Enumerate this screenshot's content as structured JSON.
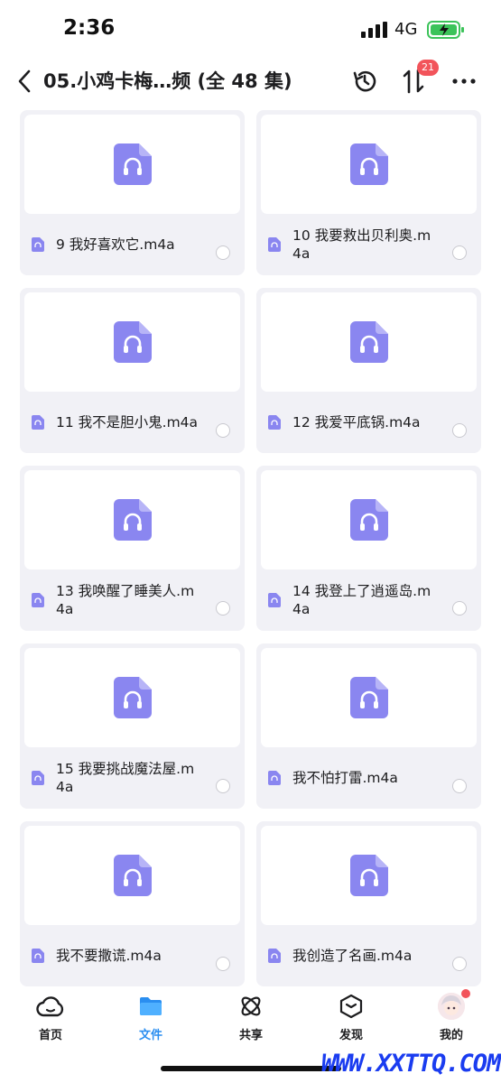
{
  "status": {
    "time": "2:36",
    "network": "4G"
  },
  "nav": {
    "title": "05.小鸡卡梅…频 (全 48 集)",
    "sort_badge": "21"
  },
  "files": [
    {
      "name": "9 我好喜欢它.m4a"
    },
    {
      "name": "10 我要救出贝利奥.m4a"
    },
    {
      "name": "11 我不是胆小鬼.m4a"
    },
    {
      "name": "12 我爱平底锅.m4a"
    },
    {
      "name": "13 我唤醒了睡美人.m4a"
    },
    {
      "name": "14 我登上了逍遥岛.m4a"
    },
    {
      "name": "15 我要挑战魔法屋.m4a"
    },
    {
      "name": "我不怕打雷.m4a"
    },
    {
      "name": "我不要撒谎.m4a"
    },
    {
      "name": "我创造了名画.m4a"
    }
  ],
  "tabs": [
    {
      "label": "首页",
      "icon": "cloud-icon"
    },
    {
      "label": "文件",
      "icon": "folder-icon"
    },
    {
      "label": "共享",
      "icon": "share-atom-icon"
    },
    {
      "label": "发现",
      "icon": "discover-cube-icon"
    },
    {
      "label": "我的",
      "icon": "avatar"
    }
  ],
  "watermark": "WWW.XXTTQ.COM",
  "colors": {
    "accent": "#2a8ef0",
    "audio_icon": "#8a86f0",
    "badge": "#f2545b",
    "card_bg": "#f1f1f6",
    "watermark": "#1a3cf0"
  }
}
